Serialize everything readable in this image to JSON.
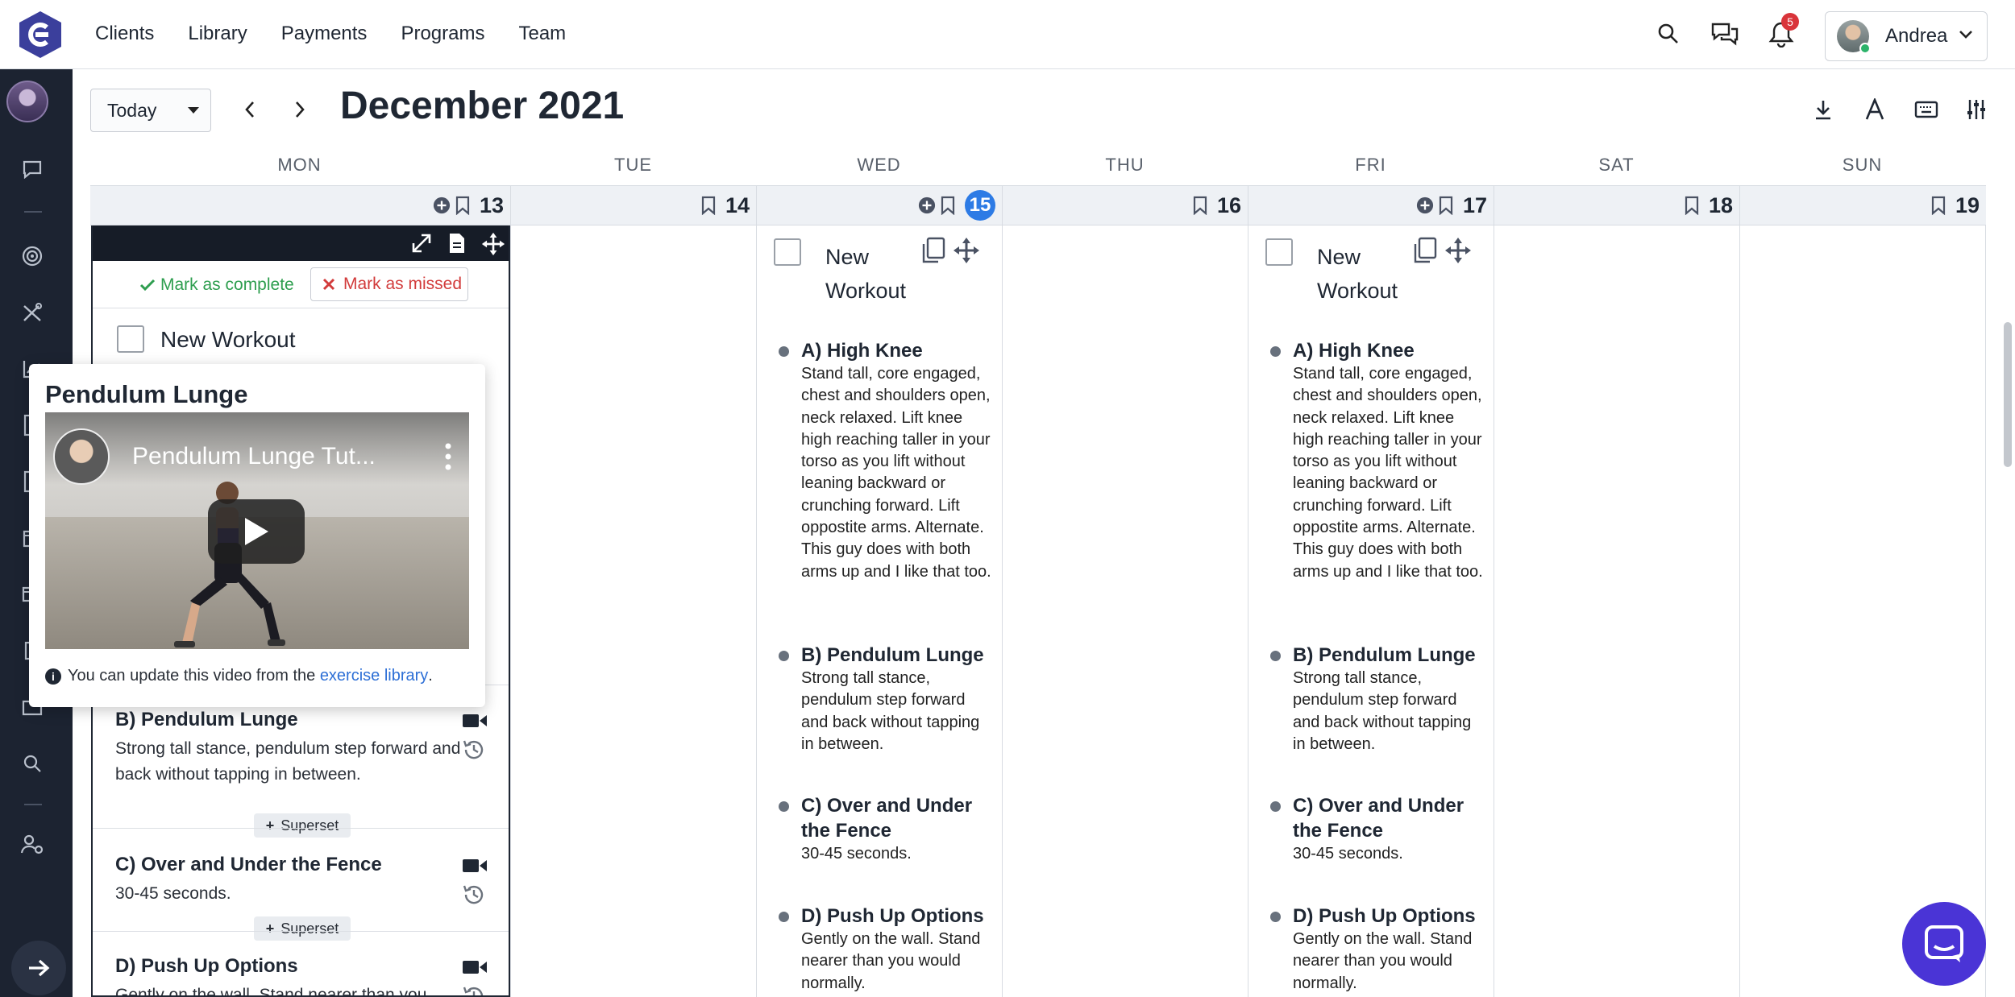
{
  "nav": {
    "items": [
      "Clients",
      "Library",
      "Payments",
      "Programs",
      "Team"
    ]
  },
  "header": {
    "notifications_count": "5",
    "user_name": "Andrea"
  },
  "calendar": {
    "today_label": "Today",
    "month_title": "December 2021",
    "weekdays": [
      "MON",
      "TUE",
      "WED",
      "THU",
      "FRI",
      "SAT",
      "SUN"
    ],
    "dates": [
      "13",
      "14",
      "15",
      "16",
      "17",
      "18",
      "19"
    ]
  },
  "monday": {
    "mark_complete": "Mark as complete",
    "mark_missed": "Mark as missed",
    "workout_title": "New Workout",
    "exercises": [
      {
        "name": "B) Pendulum Lunge",
        "desc": " Strong tall stance, pendulum step forward and back without tapping in between."
      },
      {
        "name": "C) Over and Under the Fence",
        "desc": "30-45 seconds."
      },
      {
        "name": "D) Push Up Options",
        "desc": "Gently on the wall. Stand nearer than you"
      }
    ],
    "superset_label": "Superset"
  },
  "popover": {
    "title": "Pendulum Lunge",
    "video_title": "Pendulum Lunge Tut...",
    "note_prefix": "You can update this video from the ",
    "note_link": "exercise library",
    "note_suffix": "."
  },
  "workout_days": [
    {
      "title": "New Workout",
      "exercises": [
        {
          "name": "A) High Knee",
          "desc": "Stand tall, core engaged, chest and shoulders open, neck relaxed. Lift knee high reaching taller in your torso as you lift without leaning backward or crunching forward. Lift oppostite arms. Alternate. This guy does with both arms up and I like that too."
        },
        {
          "name": "B) Pendulum Lunge",
          "desc": "Strong tall stance, pendulum step forward and back without tapping in between."
        },
        {
          "name": "C) Over and Under the Fence",
          "desc": "30-45 seconds."
        },
        {
          "name": "D) Push Up Options",
          "desc": "Gently on the wall. Stand nearer than you would normally."
        }
      ]
    },
    {
      "title": "New Workout",
      "exercises": [
        {
          "name": "A) High Knee",
          "desc": "Stand tall, core engaged, chest and shoulders open, neck relaxed. Lift knee high reaching taller in your torso as you lift without leaning backward or crunching forward. Lift oppostite arms. Alternate. This guy does with both arms up and I like that too."
        },
        {
          "name": "B) Pendulum Lunge",
          "desc": "Strong tall stance, pendulum step forward and back without tapping in between."
        },
        {
          "name": "C) Over and Under the Fence",
          "desc": "30-45 seconds."
        },
        {
          "name": "D) Push Up Options",
          "desc": "Gently on the wall. Stand nearer than you would normally."
        }
      ]
    }
  ],
  "colors": {
    "accent": "#2d7be5",
    "sidebar": "#1c2331",
    "complete": "#2e9e4f",
    "missed": "#d23b3b",
    "chat": "#4a34d6"
  }
}
